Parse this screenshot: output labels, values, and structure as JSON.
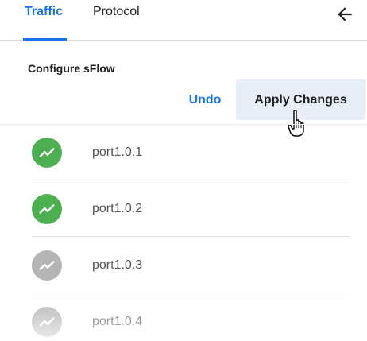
{
  "tabs": [
    {
      "label": "Traffic",
      "active": true
    },
    {
      "label": "Protocol",
      "active": false
    }
  ],
  "icons": {
    "back": "arrow-left-icon",
    "port_status": "trending-up-icon",
    "cursor": "hand-pointer-icon"
  },
  "section_title": "Configure sFlow",
  "actions": {
    "undo_label": "Undo",
    "apply_label": "Apply Changes"
  },
  "colors": {
    "accent": "#1a73e8",
    "apply_bg": "#e8eef8",
    "status_active": "#4caf50",
    "status_inactive": "#b5b5b5"
  },
  "ports": [
    {
      "name": "port1.0.1",
      "status": "active"
    },
    {
      "name": "port1.0.2",
      "status": "active"
    },
    {
      "name": "port1.0.3",
      "status": "inactive"
    },
    {
      "name": "port1.0.4",
      "status": "inactive"
    }
  ]
}
